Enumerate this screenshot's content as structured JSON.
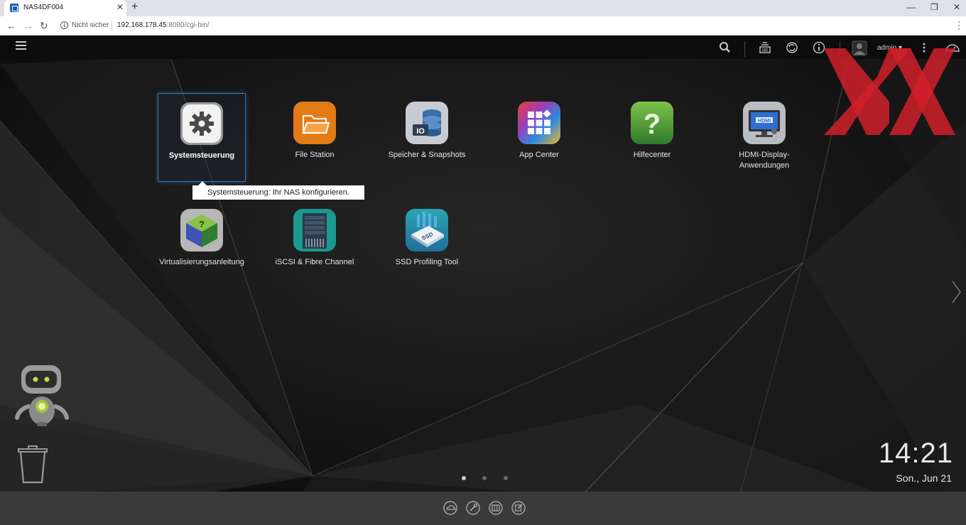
{
  "browser": {
    "tab_title": "NAS4DF004",
    "tab_close": "✕",
    "new_tab": "+",
    "not_secure": "Nicht sicher",
    "url_host": "192.168.178.45",
    "url_rest": ":8080/cgi-bin/",
    "minimize": "—",
    "restore": "❐",
    "close": "✕",
    "back": "←",
    "forward": "→",
    "reload": "↻",
    "menu": "⋮"
  },
  "topbar": {
    "user": "admin ▾",
    "icons": [
      "search-icon",
      "tasks-icon",
      "sync-icon",
      "info-icon",
      "user-icon",
      "more-icon",
      "dashboard-icon"
    ]
  },
  "apps": [
    {
      "label": "Systemsteuerung",
      "icon": "gear-icon"
    },
    {
      "label": "File Station",
      "icon": "folder-icon"
    },
    {
      "label": "Speicher & Snapshots",
      "icon": "storage-icon"
    },
    {
      "label": "App Center",
      "icon": "app-grid-icon"
    },
    {
      "label": "Hilfecenter",
      "icon": "help-icon"
    },
    {
      "label": "HDMI-Display-Anwendungen",
      "icon": "hdmi-monitor-icon"
    },
    {
      "label": "Virtualisierungsanleitung",
      "icon": "virtualization-cube-icon"
    },
    {
      "label": "iSCSI & Fibre Channel",
      "icon": "server-icon"
    },
    {
      "label": "SSD Profiling Tool",
      "icon": "ssd-icon"
    }
  ],
  "tooltip": "Systemsteuerung: Ihr NAS konfigurieren.",
  "clock": {
    "time": "14:21",
    "date": "Son., Jun 21"
  },
  "pagination": {
    "pages": 3,
    "current": 1
  },
  "dock": {
    "icons": [
      "cloud-icon",
      "tools-icon",
      "columns-icon",
      "edit-icon"
    ]
  },
  "colors": {
    "selection": "#3a78c2",
    "dock": "#3a3a3a",
    "topbar": "#0c0c0c"
  }
}
